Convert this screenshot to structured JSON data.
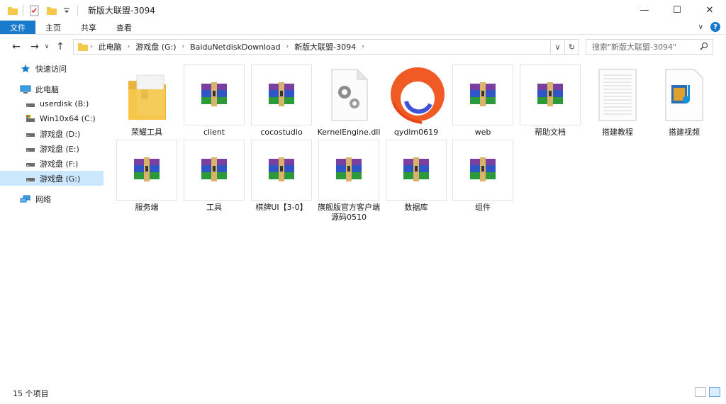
{
  "window": {
    "title": "新版大联盟-3094",
    "minimize": "—",
    "maximize": "☐",
    "close": "✕"
  },
  "ribbon": {
    "tabs": [
      "文件",
      "主页",
      "共享",
      "查看"
    ],
    "expand": "∨",
    "help": "?"
  },
  "nav": {
    "back": "←",
    "forward": "→",
    "recent": "∨",
    "up": "↑",
    "breadcrumb": [
      "此电脑",
      "游戏盘 (G:)",
      "BaiduNetdiskDownload",
      "新版大联盟-3094"
    ],
    "search_placeholder": "搜索\"新版大联盟-3094\""
  },
  "sidebar": {
    "items": [
      {
        "label": "快速访问",
        "icon": "star-icon"
      },
      {
        "label": "此电脑",
        "icon": "computer-icon"
      },
      {
        "label": "userdisk (B:)",
        "icon": "drive-icon"
      },
      {
        "label": "Win10x64 (C:)",
        "icon": "system-drive-icon"
      },
      {
        "label": "游戏盘 (D:)",
        "icon": "drive-icon"
      },
      {
        "label": "游戏盘 (E:)",
        "icon": "drive-icon"
      },
      {
        "label": "游戏盘 (F:)",
        "icon": "drive-icon"
      },
      {
        "label": "游戏盘 (G:)",
        "icon": "drive-icon",
        "selected": true
      },
      {
        "label": "网络",
        "icon": "network-icon"
      }
    ]
  },
  "files": [
    {
      "name": "荣耀工具",
      "type": "folder"
    },
    {
      "name": "client",
      "type": "archive"
    },
    {
      "name": "cocostudio",
      "type": "archive"
    },
    {
      "name": "KernelEngine.dll",
      "type": "dll"
    },
    {
      "name": "qydlm0619",
      "type": "app"
    },
    {
      "name": "web",
      "type": "archive"
    },
    {
      "name": "帮助文档",
      "type": "archive"
    },
    {
      "name": "搭建教程",
      "type": "text"
    },
    {
      "name": "搭建视频",
      "type": "video"
    },
    {
      "name": "服务端",
      "type": "archive"
    },
    {
      "name": "工具",
      "type": "archive"
    },
    {
      "name": "棋牌UI【3-0】",
      "type": "archive"
    },
    {
      "name": "旗舰版官方客户端源码0510",
      "type": "archive"
    },
    {
      "name": "数据库",
      "type": "archive"
    },
    {
      "name": "组件",
      "type": "archive"
    }
  ],
  "status": {
    "count": "15 个项目"
  },
  "colors": {
    "accent": "#1979ca",
    "selection": "#cce8ff",
    "folder": "#f5c84c"
  }
}
